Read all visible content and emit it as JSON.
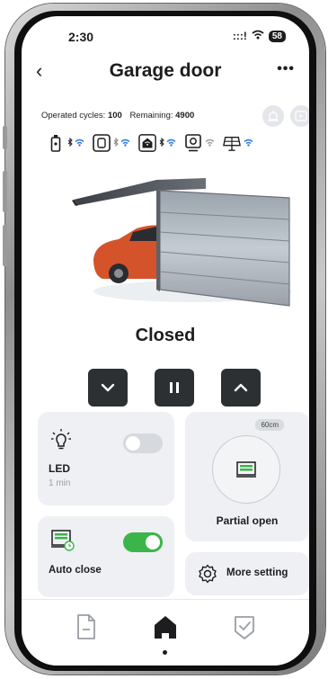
{
  "status_bar": {
    "time": "2:30",
    "signal": ":::!",
    "battery": "58"
  },
  "header": {
    "title": "Garage door",
    "back_icon": "chevron-left-icon",
    "more_icon": "more-icon"
  },
  "cycles": {
    "operated_label": "Operated cycles:",
    "operated_value": "100",
    "remaining_label": "Remaining:",
    "remaining_value": "4900"
  },
  "devices": [
    "remote-icon",
    "hub-icon",
    "garage-opener-icon",
    "camera-icon",
    "solar-panel-icon"
  ],
  "door": {
    "state": "Closed"
  },
  "controls": [
    "chevron-down-icon",
    "pause-icon",
    "chevron-up-icon"
  ],
  "led_card": {
    "title": "LED",
    "subtitle": "1 min",
    "enabled": false
  },
  "partial_card": {
    "badge": "60cm",
    "label": "Partial open"
  },
  "auto_close_card": {
    "title": "Auto close",
    "enabled": true
  },
  "more_card": {
    "label": "More setting"
  },
  "nav": {
    "items": [
      "document-icon",
      "home-icon",
      "shield-check-icon"
    ],
    "active": 1
  },
  "colors": {
    "accent_green": "#3bb54a",
    "dark_button": "#2d3033",
    "card_bg": "#eef0f3",
    "wifi_blue": "#2f7ae5"
  }
}
